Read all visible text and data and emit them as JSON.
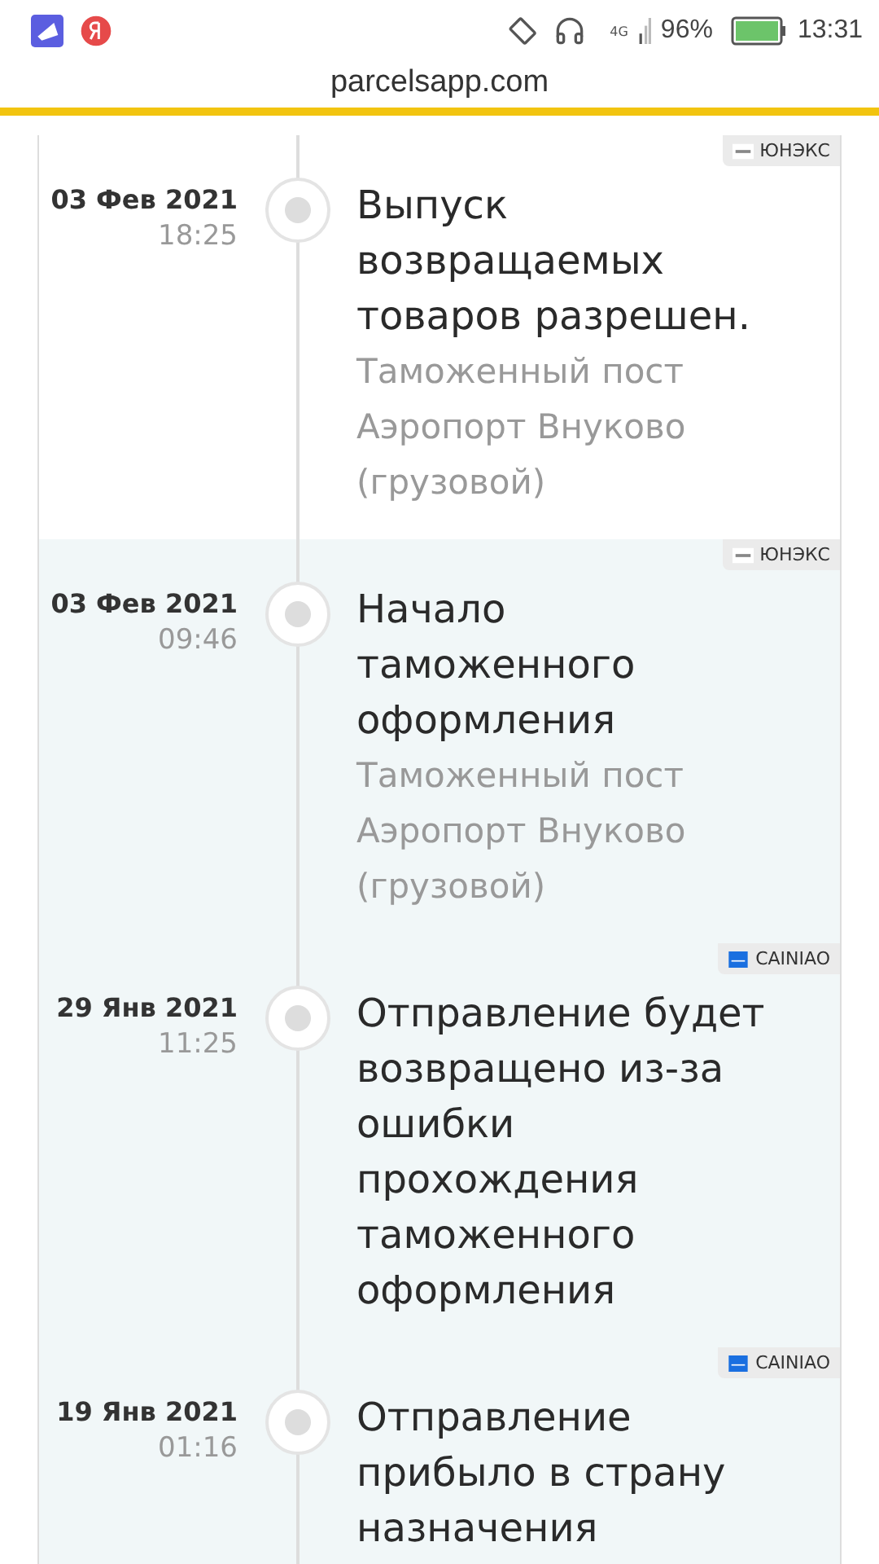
{
  "status_bar": {
    "battery_percent": "96%",
    "time": "13:31",
    "network": "4G"
  },
  "address_bar": {
    "url": "parcelsapp.com"
  },
  "events": [
    {
      "date": "03 Фев 2021",
      "time": "18:25",
      "title": "Выпуск возвращаемых товаров разрешен.",
      "location": "Таможенный пост Аэропорт Внуково (грузовой)",
      "carrier": "ЮНЭКС",
      "kind": "unex",
      "shaded": false
    },
    {
      "date": "03 Фев 2021",
      "time": "09:46",
      "title": "Начало таможенного оформления",
      "location": "Таможенный пост Аэропорт Внуково (грузовой)",
      "carrier": "ЮНЭКС",
      "kind": "unex",
      "shaded": true
    },
    {
      "date": "29 Янв 2021",
      "time": "11:25",
      "title": "Отправление будет возвращено из-за ошибки прохождения таможенного оформления",
      "carrier": "CAINIAO",
      "kind": "cainiao",
      "shaded": true
    },
    {
      "date": "19 Янв 2021",
      "time": "01:16",
      "title": "Отправление прибыло в страну назначения",
      "carrier": "CAINIAO",
      "kind": "cainiao",
      "shaded": true
    }
  ]
}
